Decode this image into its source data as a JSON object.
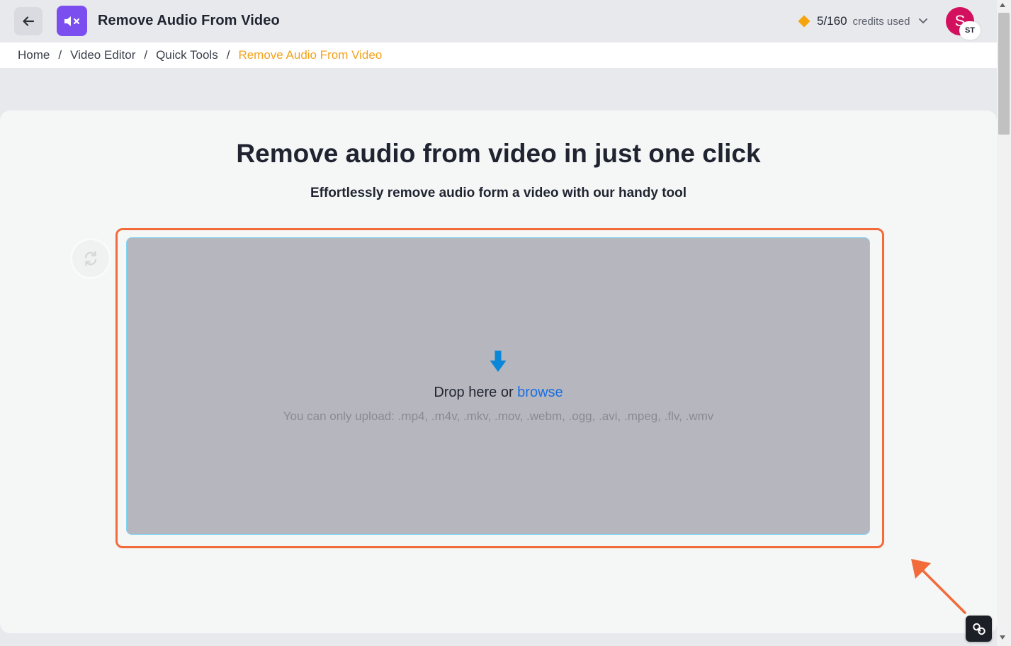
{
  "header": {
    "title": "Remove Audio From Video",
    "credits_count": "5/160",
    "credits_label": "credits used",
    "avatar_initial": "S",
    "avatar_badge": "ST",
    "icons": [
      "back-arrow-icon",
      "mute-speaker-icon",
      "diamond-icon",
      "chevron-down-icon"
    ]
  },
  "breadcrumb": {
    "items": [
      "Home",
      "Video Editor",
      "Quick Tools",
      "Remove Audio From Video"
    ],
    "separator": "/"
  },
  "main": {
    "title": "Remove audio from video in just one click",
    "subtitle": "Effortlessly remove audio form a video with our handy tool"
  },
  "dropzone": {
    "drop_text": "Drop here or",
    "browse_label": "browse",
    "allowed_text": "You can only upload: .mp4, .m4v, .mkv, .mov, .webm, .ogg, .avi, .mpeg, .flv, .wmv"
  },
  "colors": {
    "accent": "#7b4ef0",
    "breadcrumb_active": "#f3a21b",
    "highlight": "#f26b3a",
    "link": "#1a6fe0",
    "avatar": "#d3105d"
  }
}
